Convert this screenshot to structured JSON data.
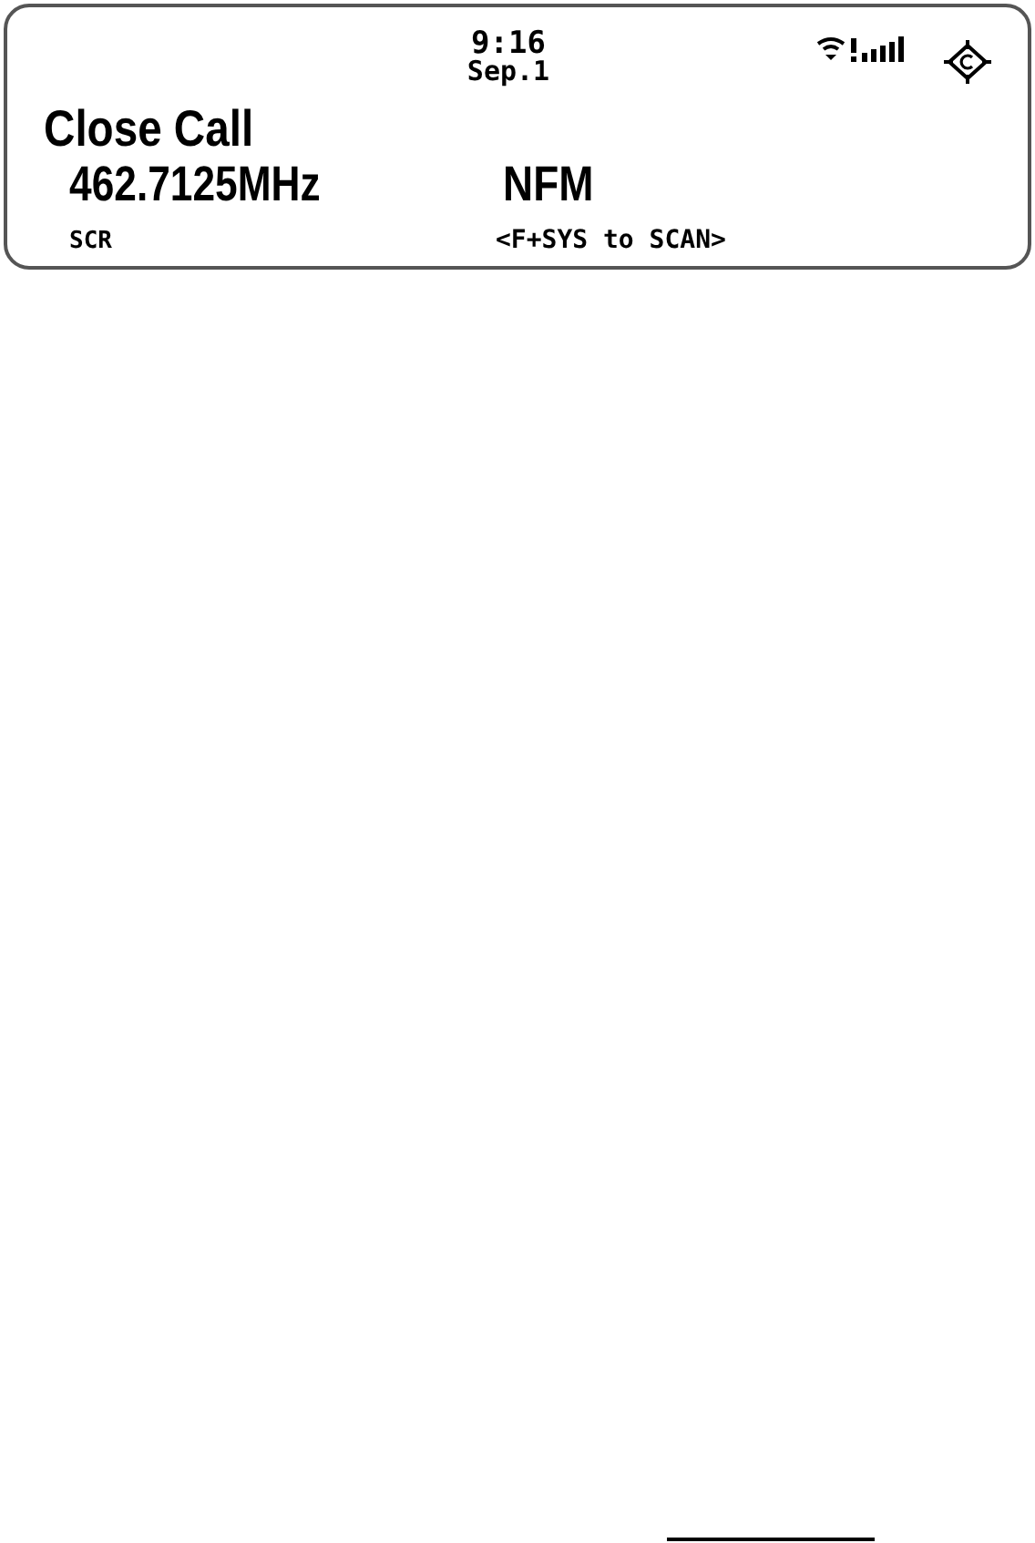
{
  "status": {
    "time": "9:16",
    "date": "Sep.1"
  },
  "mode": "Close Call",
  "frequency": "462.7125MHz",
  "modulation": "NFM",
  "footer": {
    "left": "SCR",
    "hint": "<F+SYS to SCAN>"
  }
}
